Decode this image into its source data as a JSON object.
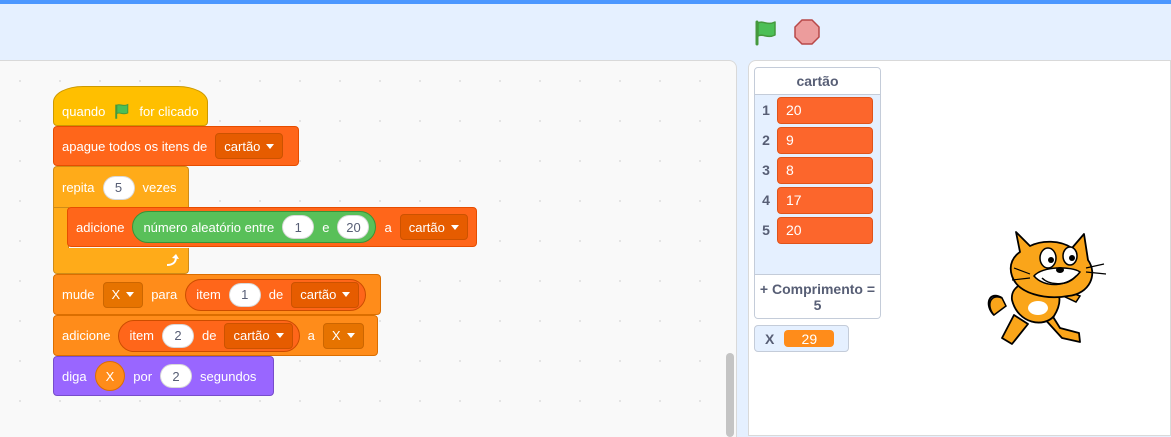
{
  "header": {
    "green_flag_icon": "green-flag-icon",
    "stop_icon": "stop-icon"
  },
  "colors": {
    "events": "#ffbf00",
    "data": "#ff661a",
    "control": "#ffab19",
    "variables": "#ff8c1a",
    "looks": "#9966ff",
    "operators": "#59c059",
    "accent": "#4c97ff"
  },
  "script": {
    "when_clicked": {
      "prefix": "quando",
      "suffix": "for clicado"
    },
    "delete_all": {
      "label": "apague todos os itens de",
      "list": "cartão"
    },
    "repeat": {
      "label": "repita",
      "times": "5",
      "suffix": "vezes"
    },
    "add_random": {
      "label": "adicione",
      "random_label": "número aleatório entre",
      "from": "1",
      "and_label": "e",
      "to": "20",
      "to_label": "a",
      "list": "cartão"
    },
    "set_var": {
      "label": "mude",
      "var": "X",
      "to_label": "para",
      "item_label": "item",
      "index": "1",
      "of_label": "de",
      "list": "cartão"
    },
    "add_item": {
      "label": "adicione",
      "item_label": "item",
      "index": "2",
      "of_label": "de",
      "list": "cartão",
      "to_label": "a",
      "target": "X"
    },
    "say": {
      "label": "diga",
      "var": "X",
      "for_label": "por",
      "seconds": "2",
      "suffix": "segundos"
    }
  },
  "stage": {
    "list_monitor": {
      "title": "cartão",
      "items": [
        {
          "index": "1",
          "value": "20"
        },
        {
          "index": "2",
          "value": "9"
        },
        {
          "index": "3",
          "value": "8"
        },
        {
          "index": "4",
          "value": "17"
        },
        {
          "index": "5",
          "value": "20"
        }
      ],
      "add_label": "+ Comprimento =",
      "length": "5"
    },
    "var_monitor": {
      "name": "X",
      "value": "29"
    },
    "sprite": "cat-sprite"
  }
}
